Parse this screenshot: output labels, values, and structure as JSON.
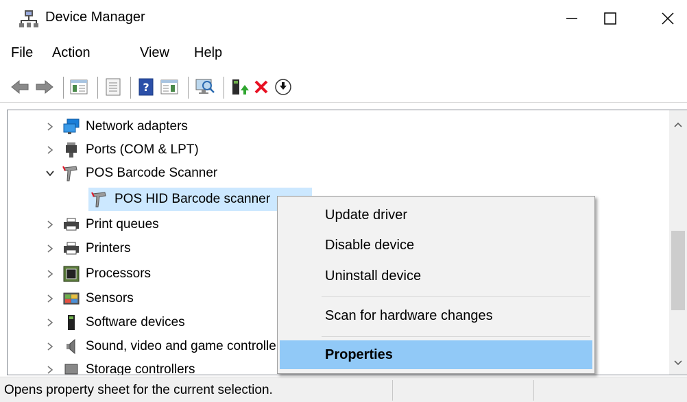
{
  "window": {
    "title": "Device Manager"
  },
  "menu": {
    "file": "File",
    "action": "Action",
    "view": "View",
    "help": "Help"
  },
  "tree": {
    "network_adapters": "Network adapters",
    "ports": "Ports (COM & LPT)",
    "pos_barcode_scanner": "POS Barcode Scanner",
    "pos_hid": "POS HID Barcode scanner",
    "print_queues": "Print queues",
    "printers": "Printers",
    "processors": "Processors",
    "sensors": "Sensors",
    "software_devices": "Software devices",
    "sound": "Sound, video and game controllers",
    "storage": "Storage controllers"
  },
  "context_menu": {
    "update_driver": "Update driver",
    "disable_device": "Disable device",
    "uninstall_device": "Uninstall device",
    "scan_hardware": "Scan for hardware changes",
    "properties": "Properties"
  },
  "status": {
    "text": "Opens property sheet for the current selection."
  },
  "colors": {
    "selection": "#cce8ff",
    "menu_highlight": "#91c9f7",
    "accent_blue": "#1e78d2",
    "delete_red": "#e81123"
  }
}
